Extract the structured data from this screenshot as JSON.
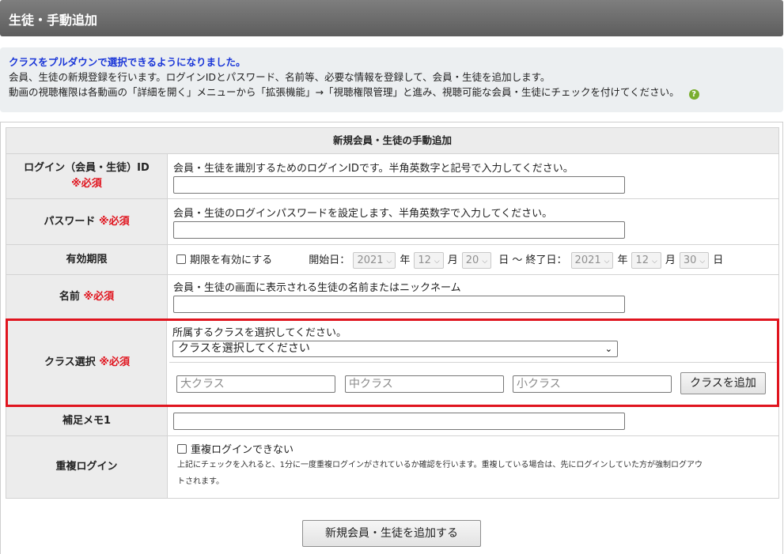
{
  "header": {
    "title": "生徒・手動追加"
  },
  "info": {
    "notice": "クラスをプルダウンで選択できるようになりました。",
    "line1": "会員、生徒の新規登録を行います。ログインIDとパスワード、名前等、必要な情報を登録して、会員・生徒を追加します。",
    "line2": "動画の視聴権限は各動画の「詳細を開く」メニューから「拡張機能」→「視聴権限管理」と進み、視聴可能な会員・生徒にチェックを付けてください。",
    "help_icon": "question-circle-icon",
    "help_glyph": "?"
  },
  "form": {
    "title": "新規会員・生徒の手動追加",
    "required_mark": "※必須",
    "login_id": {
      "label": "ログイン（会員・生徒）ID",
      "desc": "会員・生徒を識別するためのログインIDです。半角英数字と記号で入力してください。",
      "value": ""
    },
    "password": {
      "label": "パスワード",
      "desc": "会員・生徒のログインパスワードを設定します、半角英数字で入力してください。",
      "value": ""
    },
    "validity": {
      "label": "有効期限",
      "checkbox_label": "期限を有効にする",
      "start_label": "開始日：",
      "start_year": "2021",
      "start_month": "12",
      "start_day": "20",
      "end_label": "日 ～ 終了日：",
      "end_year": "2021",
      "end_month": "12",
      "end_day": "30",
      "unit_year": "年",
      "unit_month": "月",
      "unit_day": "日",
      "chevron": "⌵"
    },
    "name": {
      "label": "名前",
      "desc": "会員・生徒の画面に表示される生徒の名前またはニックネーム",
      "value": ""
    },
    "class_select": {
      "label": "クラス選択",
      "desc": "所属するクラスを選択してください。",
      "selected": "クラスを選択してください",
      "chevron": "⌄",
      "large_placeholder": "大クラス",
      "middle_placeholder": "中クラス",
      "small_placeholder": "小クラス",
      "add_button": "クラスを追加"
    },
    "memo1": {
      "label": "補足メモ1",
      "value": ""
    },
    "duplicate_login": {
      "label": "重複ログイン",
      "checkbox_label": "重複ログインできない",
      "note1": "上記にチェックを入れると、1分に一度重複ログインがされているか確認を行います。重複している場合は、先にログインしていた方が強制ログアウ",
      "note2": "トされます。"
    },
    "submit_button": "新規会員・生徒を追加する"
  },
  "colors": {
    "required": "#e0141e",
    "notice": "#1a36d8",
    "highlight_border": "#e0141e",
    "header_bg": "#6e6e6e"
  }
}
